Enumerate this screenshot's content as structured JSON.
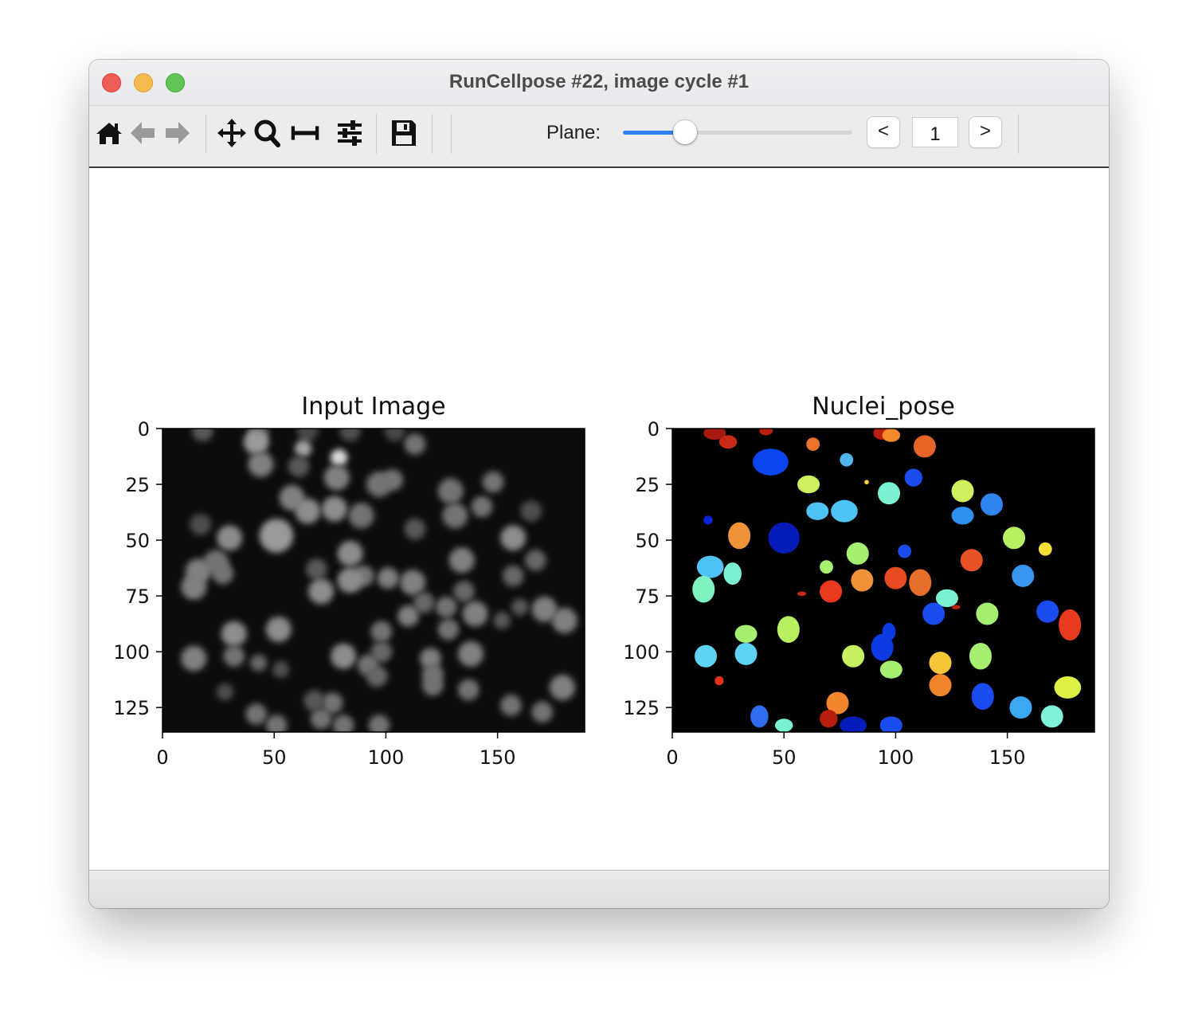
{
  "window": {
    "title": "RunCellpose #22, image cycle #1"
  },
  "toolbar": {
    "icons": [
      "home-icon",
      "back-arrow-icon",
      "forward-arrow-icon",
      "pan-icon",
      "zoom-icon",
      "subplots-icon",
      "configure-icon",
      "save-icon"
    ],
    "plane_label": "Plane:",
    "plane_slider_fraction": 0.27,
    "prev_label": "<",
    "next_label": ">",
    "plane_value": "1"
  },
  "colors": {
    "slider_accent": "#2f7ff0",
    "mask_background": "#000000",
    "input_background": "#0c0c0c"
  },
  "chart_data": [
    {
      "type": "heatmap",
      "title": "Input Image",
      "colormap": "gray",
      "xlim": [
        0,
        189
      ],
      "ylim": [
        136,
        0
      ],
      "xticks": [
        0,
        50,
        100,
        150
      ],
      "yticks": [
        0,
        25,
        50,
        75,
        100,
        125
      ],
      "xtick_labels": [
        "0",
        "50",
        "100",
        "150"
      ],
      "ytick_labels": [
        "0",
        "25",
        "50",
        "75",
        "100",
        "125"
      ],
      "blobs": [
        [
          18,
          1,
          5,
          0.35
        ],
        [
          43,
          1,
          5,
          0.3
        ],
        [
          65,
          1,
          5,
          0.28
        ],
        [
          84,
          1,
          5,
          0.3
        ],
        [
          104,
          1,
          5,
          0.28
        ],
        [
          42,
          6,
          6,
          0.6
        ],
        [
          63,
          9,
          4,
          0.65
        ],
        [
          79,
          13,
          4,
          0.85
        ],
        [
          113,
          7,
          5,
          0.45
        ],
        [
          103,
          23,
          5,
          0.45
        ],
        [
          44,
          16,
          6,
          0.5
        ],
        [
          61,
          17,
          5,
          0.35
        ],
        [
          78,
          22,
          6,
          0.5
        ],
        [
          97,
          25,
          6,
          0.45
        ],
        [
          129,
          28,
          6,
          0.45
        ],
        [
          148,
          24,
          5,
          0.45
        ],
        [
          58,
          31,
          6,
          0.5
        ],
        [
          65,
          37,
          6,
          0.55
        ],
        [
          77,
          36,
          6,
          0.55
        ],
        [
          89,
          39,
          6,
          0.45
        ],
        [
          131,
          39,
          6,
          0.45
        ],
        [
          143,
          35,
          5,
          0.45
        ],
        [
          165,
          37,
          5,
          0.3
        ],
        [
          17,
          43,
          5,
          0.3
        ],
        [
          30,
          49,
          6,
          0.55
        ],
        [
          51,
          48,
          8,
          0.6
        ],
        [
          84,
          56,
          6,
          0.55
        ],
        [
          113,
          45,
          5,
          0.35
        ],
        [
          157,
          49,
          6,
          0.55
        ],
        [
          167,
          59,
          5,
          0.4
        ],
        [
          24,
          60,
          6,
          0.45
        ],
        [
          16,
          64,
          6,
          0.5
        ],
        [
          27,
          65,
          5,
          0.45
        ],
        [
          69,
          63,
          5,
          0.35
        ],
        [
          90,
          66,
          5,
          0.45
        ],
        [
          101,
          67,
          5,
          0.5
        ],
        [
          112,
          69,
          6,
          0.5
        ],
        [
          134,
          59,
          6,
          0.5
        ],
        [
          135,
          73,
          5,
          0.4
        ],
        [
          157,
          66,
          5,
          0.4
        ],
        [
          14,
          71,
          6,
          0.5
        ],
        [
          84,
          68,
          6,
          0.55
        ],
        [
          71,
          73,
          6,
          0.55
        ],
        [
          117,
          78,
          5,
          0.4
        ],
        [
          127,
          80,
          5,
          0.45
        ],
        [
          160,
          80,
          4,
          0.35
        ],
        [
          171,
          81,
          6,
          0.5
        ],
        [
          180,
          86,
          6,
          0.5
        ],
        [
          140,
          83,
          6,
          0.5
        ],
        [
          152,
          86,
          4,
          0.35
        ],
        [
          128,
          90,
          5,
          0.45
        ],
        [
          110,
          84,
          5,
          0.5
        ],
        [
          98,
          91,
          5,
          0.45
        ],
        [
          32,
          92,
          6,
          0.55
        ],
        [
          52,
          90,
          6,
          0.55
        ],
        [
          98,
          100,
          5,
          0.4
        ],
        [
          32,
          102,
          5,
          0.45
        ],
        [
          14,
          103,
          6,
          0.5
        ],
        [
          43,
          105,
          4,
          0.4
        ],
        [
          81,
          102,
          6,
          0.55
        ],
        [
          92,
          106,
          5,
          0.45
        ],
        [
          96,
          111,
          5,
          0.4
        ],
        [
          120,
          103,
          5,
          0.5
        ],
        [
          138,
          101,
          6,
          0.5
        ],
        [
          121,
          110,
          5,
          0.45
        ],
        [
          121,
          115,
          5,
          0.45
        ],
        [
          137,
          117,
          5,
          0.45
        ],
        [
          179,
          116,
          6,
          0.5
        ],
        [
          156,
          124,
          5,
          0.45
        ],
        [
          170,
          127,
          5,
          0.45
        ],
        [
          76,
          123,
          5,
          0.45
        ],
        [
          42,
          128,
          5,
          0.45
        ],
        [
          51,
          133,
          5,
          0.45
        ],
        [
          71,
          130,
          5,
          0.45
        ],
        [
          81,
          133,
          5,
          0.45
        ],
        [
          97,
          133,
          5,
          0.45
        ],
        [
          28,
          118,
          4,
          0.3
        ],
        [
          68,
          122,
          5,
          0.35
        ],
        [
          53,
          108,
          4,
          0.3
        ]
      ]
    },
    {
      "type": "heatmap",
      "title": "Nuclei_pose",
      "colormap": "jet",
      "xlim": [
        0,
        189
      ],
      "ylim": [
        136,
        0
      ],
      "xticks": [
        0,
        50,
        100,
        150
      ],
      "yticks": [
        0,
        25,
        50,
        75,
        100,
        125
      ],
      "xtick_labels": [
        "0",
        "50",
        "100",
        "150"
      ],
      "ytick_labels": [
        "0",
        "25",
        "50",
        "75",
        "100",
        "125"
      ],
      "objects": [
        [
          19,
          2,
          5,
          3,
          "#a6190e"
        ],
        [
          25,
          6,
          4,
          3,
          "#c92a15"
        ],
        [
          42,
          1,
          3,
          2,
          "#b81f10"
        ],
        [
          63,
          7,
          3,
          3,
          "#e8732a"
        ],
        [
          94,
          2,
          4,
          3,
          "#b81f10"
        ],
        [
          98,
          3,
          4,
          3,
          "#f58a2a"
        ],
        [
          113,
          8,
          5,
          5,
          "#e86426"
        ],
        [
          78,
          14,
          3,
          3,
          "#4fb6ee"
        ],
        [
          44,
          15,
          8,
          6,
          "#0a45f0"
        ],
        [
          61,
          25,
          5,
          4,
          "#cff05c"
        ],
        [
          87,
          24,
          1,
          1,
          "#f5d23a"
        ],
        [
          97,
          29,
          5,
          5,
          "#7af2d2"
        ],
        [
          108,
          22,
          4,
          4,
          "#1a4cf0"
        ],
        [
          130,
          28,
          5,
          5,
          "#cff05c"
        ],
        [
          143,
          34,
          5,
          5,
          "#2f84f0"
        ],
        [
          130,
          39,
          5,
          4,
          "#2f90f0"
        ],
        [
          65,
          37,
          5,
          4,
          "#4fc3f5"
        ],
        [
          77,
          37,
          6,
          5,
          "#4fc3f5"
        ],
        [
          16,
          41,
          2,
          2,
          "#0a25d8"
        ],
        [
          30,
          48,
          5,
          6,
          "#f0923a"
        ],
        [
          50,
          49,
          7,
          7,
          "#051cb8"
        ],
        [
          83,
          56,
          5,
          5,
          "#a6f071"
        ],
        [
          104,
          55,
          3,
          3,
          "#1a4cf0"
        ],
        [
          153,
          49,
          5,
          5,
          "#b8f062"
        ],
        [
          167,
          54,
          3,
          3,
          "#f5e03a"
        ],
        [
          134,
          59,
          5,
          5,
          "#e85224"
        ],
        [
          17,
          62,
          6,
          5,
          "#4fc3f5"
        ],
        [
          27,
          65,
          4,
          5,
          "#7af2d2"
        ],
        [
          69,
          62,
          3,
          3,
          "#a6f071"
        ],
        [
          85,
          68,
          5,
          5,
          "#f0923a"
        ],
        [
          100,
          67,
          5,
          5,
          "#e84a22"
        ],
        [
          111,
          69,
          5,
          6,
          "#e86e2c"
        ],
        [
          71,
          73,
          5,
          5,
          "#e83a1e"
        ],
        [
          58,
          74,
          2,
          1,
          "#c92a15"
        ],
        [
          157,
          66,
          5,
          5,
          "#3a97f0"
        ],
        [
          14,
          72,
          5,
          6,
          "#7ff2c0"
        ],
        [
          123,
          76,
          5,
          4,
          "#7af2d2"
        ],
        [
          127,
          80,
          2,
          1,
          "#b81f10"
        ],
        [
          117,
          83,
          5,
          5,
          "#1a4cf0"
        ],
        [
          141,
          83,
          5,
          5,
          "#a6f071"
        ],
        [
          168,
          82,
          5,
          5,
          "#1a4cf0"
        ],
        [
          178,
          88,
          5,
          7,
          "#e83a1e"
        ],
        [
          33,
          92,
          5,
          4,
          "#a6f071"
        ],
        [
          52,
          90,
          5,
          6,
          "#b8f062"
        ],
        [
          94,
          98,
          5,
          6,
          "#0a3ae0"
        ],
        [
          97,
          91,
          3,
          4,
          "#0a3ae0"
        ],
        [
          33,
          101,
          5,
          5,
          "#5fd3f5"
        ],
        [
          15,
          102,
          5,
          5,
          "#5fd3f5"
        ],
        [
          81,
          102,
          5,
          5,
          "#c5f060"
        ],
        [
          98,
          108,
          5,
          4,
          "#a6f071"
        ],
        [
          120,
          105,
          5,
          5,
          "#f5c53a"
        ],
        [
          138,
          102,
          5,
          6,
          "#a6f071"
        ],
        [
          120,
          115,
          5,
          5,
          "#f0852e"
        ],
        [
          139,
          120,
          5,
          6,
          "#1a4cf0"
        ],
        [
          177,
          116,
          6,
          5,
          "#dff045"
        ],
        [
          21,
          113,
          2,
          2,
          "#e8321c"
        ],
        [
          74,
          123,
          5,
          5,
          "#f0852e"
        ],
        [
          70,
          130,
          4,
          4,
          "#b81f10"
        ],
        [
          39,
          129,
          4,
          5,
          "#2f6cf0"
        ],
        [
          50,
          133,
          4,
          3,
          "#7af2d2"
        ],
        [
          81,
          133,
          6,
          4,
          "#051cb8"
        ],
        [
          98,
          133,
          5,
          4,
          "#1a4cf0"
        ],
        [
          156,
          125,
          5,
          5,
          "#3aa8f5"
        ],
        [
          170,
          129,
          5,
          5,
          "#7ff2d8"
        ]
      ]
    }
  ]
}
